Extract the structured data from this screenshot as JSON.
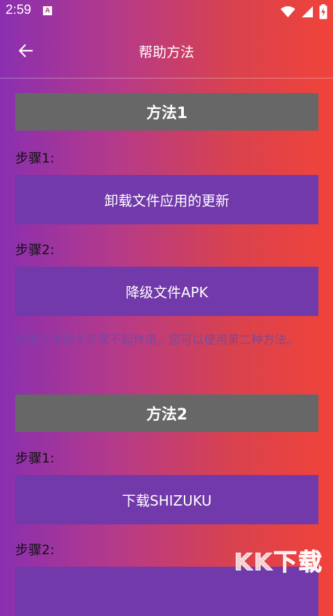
{
  "status_bar": {
    "time": "2:59",
    "notification_badge": "A",
    "icons": [
      "wifi-icon",
      "signal-icon",
      "battery-icon"
    ]
  },
  "app_bar": {
    "title": "帮助方法",
    "back_icon": "arrow-back-icon"
  },
  "methods": [
    {
      "title": "方法1",
      "steps": [
        {
          "label": "步骤1:",
          "button": "卸载文件应用的更新"
        },
        {
          "label": "步骤2:",
          "button": "降级文件APK"
        }
      ],
      "note": "如果上述两个步骤不起作用，您可以使用第二种方法。"
    },
    {
      "title": "方法2",
      "steps": [
        {
          "label": "步骤1:",
          "button": "下载SHIZUKU"
        },
        {
          "label": "步骤2:"
        }
      ]
    }
  ],
  "watermark": "KK下载",
  "colors": {
    "gradient_start": "#8a2fb0",
    "gradient_end": "#f0433a",
    "header_gray": "#676767",
    "button_purple": "#7139a9"
  }
}
